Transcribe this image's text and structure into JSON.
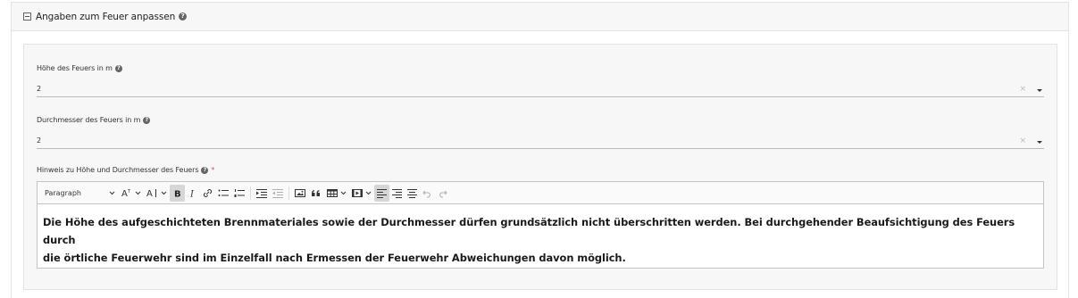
{
  "section": {
    "title": "Angaben zum Feuer anpassen"
  },
  "fields": {
    "height": {
      "label": "Höhe des Feuers in m",
      "value": "2"
    },
    "diameter": {
      "label": "Durchmesser des Feuers in m",
      "value": "2"
    },
    "note": {
      "label": "Hinweis zu Höhe und Durchmesser des Feuers",
      "required_marker": "*",
      "content_line1": "Die Höhe des aufgeschichteten Brennmateriales sowie der Durchmesser dürfen grundsätzlich nicht überschritten werden. Bei durchgehender Beaufsichtigung des Feuers durch",
      "content_line2": "die örtliche Feuerwehr sind im Einzelfall nach Ermessen der Feuerwehr Abweichungen davon möglich."
    }
  },
  "toolbar": {
    "heading_select": "Paragraph",
    "bold_active": true
  },
  "icons": {
    "help": "?",
    "clear": "×"
  },
  "colors": {
    "required": "#d9534f",
    "panel_bg": "#f7f7f7",
    "active_button": "#d6d6d6"
  }
}
